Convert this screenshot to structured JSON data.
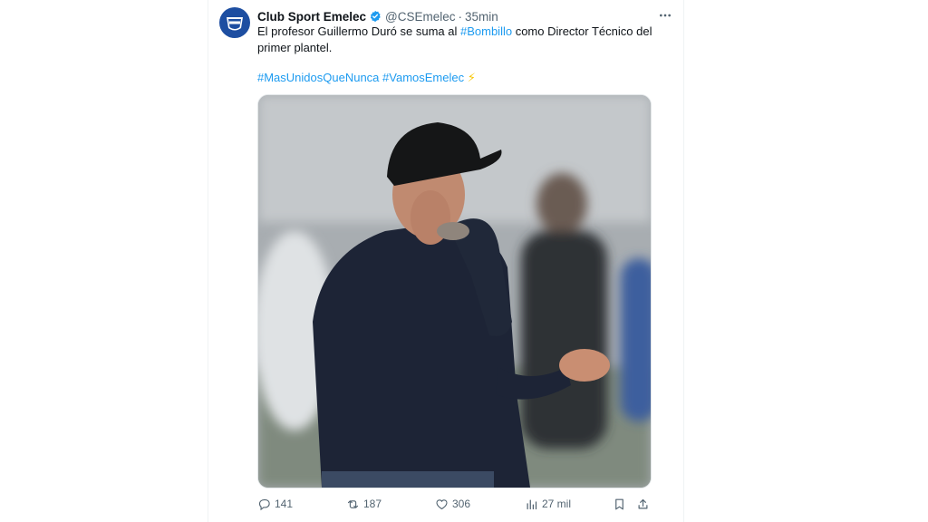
{
  "tweet": {
    "display_name": "Club Sport Emelec",
    "handle": "@CSEmelec",
    "separator": "·",
    "time": "35min",
    "text_part1": "El profesor Guillermo Duró se suma al ",
    "text_hashtag": "#Bombillo",
    "text_part2": " como Director Técnico del primer plantel.",
    "hashtag1": "#MasUnidosQueNunca",
    "hashtag2": "#VamosEmelec",
    "bolt": "⚡",
    "more_glyph": "···"
  },
  "actions": {
    "replies": "141",
    "reposts": "187",
    "likes": "306",
    "views": "27 mil"
  },
  "avatar_logo_text": "EMELEC",
  "icons": {
    "verified": "verified-badge-icon",
    "reply": "reply-icon",
    "repost": "repost-icon",
    "like": "like-icon",
    "views": "views-icon",
    "bookmark": "bookmark-icon",
    "share": "share-icon"
  },
  "colors": {
    "link": "#1d9bf0",
    "muted": "#536471",
    "brand_blue": "#1d4ea1"
  }
}
